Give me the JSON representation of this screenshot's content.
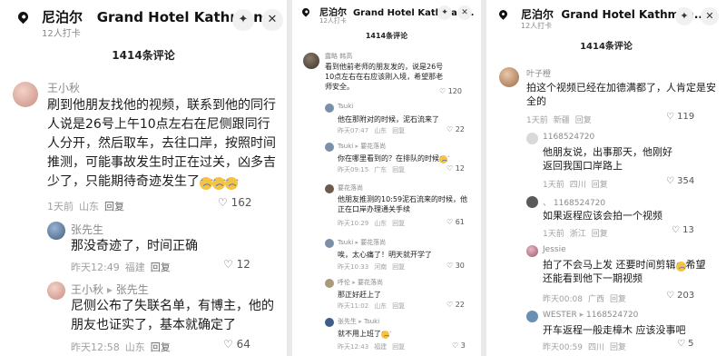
{
  "colors": {
    "meta_gray": "#a0a0a0",
    "username_gray": "#8a8a8a",
    "emoji_yellow": "#f5c242",
    "divider": "#e9e9e9"
  },
  "icons": {
    "location": "location-pin-icon",
    "sparkle": "sparkle-icon",
    "close": "close-icon",
    "heart": "heart-icon",
    "emoji": "crying-emoji-icon"
  },
  "panel1": {
    "title": "尼泊尔",
    "hotel": "Grand Hotel Kathman...",
    "checkin": "12人打卡",
    "count": "1414条评论",
    "comments": [
      {
        "user": "王小秋",
        "text": "刷到他朋友找他的视频，联系到他的同行人说是26号上午10点左右在尼侧跟同行人分开，然后取车，去往口岸，按照时间推测，可能事故发生时正在过关，凶多吉少了，只能期待奇迹发生了",
        "time": "1天前",
        "loc": "山东",
        "reply": "回复",
        "likes": "162"
      },
      {
        "user": "张先生",
        "text": "那没奇迹了，时间正确",
        "time": "昨天12:49",
        "loc": "福建",
        "reply": "回复",
        "likes": "12"
      },
      {
        "user": "王小秋",
        "reply_to": "张先生",
        "text": "尼侧公布了失联名单，有博主，他的朋友也证实了，基本就确定了",
        "time": "昨天12:58",
        "loc": "山东",
        "reply": "回复",
        "likes": "64"
      }
    ]
  },
  "panel2": {
    "title": "尼泊尔",
    "hotel": "Grand Hotel Kathman...",
    "checkin": "12人打卡",
    "count": "1414条评论",
    "comments": [
      {
        "user": "露略 韩高",
        "text": "看到他前老师的朋友发的，说是26号10点左右在右应该刚入境，希望那老师安全。",
        "time": "",
        "loc": "",
        "reply": "",
        "likes": "120"
      },
      {
        "user": "Tsuki",
        "text": "他在那附对的时候，泥石流来了",
        "time": "昨天07:47",
        "loc": "山东",
        "reply": "回复",
        "likes": "22"
      },
      {
        "user": "Tsuki",
        "reply_to": "要花落尚",
        "text": "你在哪里看到的？在排队的时候",
        "time": "昨天09:15",
        "loc": "广东",
        "reply": "回复",
        "likes": "12"
      },
      {
        "user": "要花落尚",
        "text": "他朋友推测的10:59泥石流来的时候，他正在口岸办理通关手续",
        "time": "昨天10:29",
        "loc": "山东",
        "reply": "回复",
        "likes": "61"
      },
      {
        "user": "Tsuki",
        "reply_to": "要花落尚",
        "text": "唉，太心痛了！明天就开学了",
        "time": "昨天10:33",
        "loc": "河南",
        "reply": "回复",
        "likes": "30"
      },
      {
        "user": "呼伦",
        "reply_to": "要花落尚",
        "text": "那正好赶上了",
        "time": "昨天11:02",
        "loc": "山东",
        "reply": "回复",
        "likes": "22"
      },
      {
        "user": "张先生",
        "reply_to": "Tsuki",
        "text": "就不用上班了",
        "time": "昨天12:43",
        "loc": "福建",
        "reply": "回复",
        "likes": "3"
      }
    ]
  },
  "panel3": {
    "title": "尼泊尔",
    "hotel": "Grand Hotel Kathman...",
    "checkin": "12人打卡",
    "count": "1414条评论",
    "comments": [
      {
        "user": "叶子橙",
        "text": "拍这个视频已经在加德满都了，人肯定是安全的",
        "time": "1天前",
        "loc": "新疆",
        "reply": "回复",
        "likes": "119"
      },
      {
        "user": "1168524720",
        "text": "他朋友说，出事那天，他刚好返回我国口岸路上",
        "time": "1天前",
        "loc": "四川",
        "reply": "回复",
        "likes": "354"
      },
      {
        "user": "1168524720",
        "text": "如果返程应该会拍一个视频",
        "time": "1天前",
        "loc": "浙江",
        "reply": "回复",
        "likes": "13"
      },
      {
        "user": "Jessie",
        "text": "拍了不会马上发 还要时间剪辑",
        "text2": "希望还能看到他下一期视频",
        "time": "昨天00:08",
        "loc": "广西",
        "reply": "回复",
        "likes": "203"
      },
      {
        "user": "WESTER",
        "reply_to": "1168524720",
        "text": "开车返程一般走樟木 应该没事吧",
        "time": "昨天00:59",
        "loc": "四川",
        "reply": "回复",
        "likes": "5"
      }
    ]
  }
}
